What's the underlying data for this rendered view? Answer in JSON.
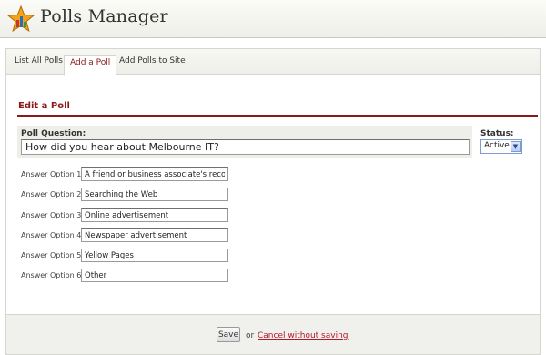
{
  "app": {
    "title": "Polls Manager",
    "logo_icon": "star-chart-icon"
  },
  "tabs": [
    {
      "label": "List All Polls",
      "active": false
    },
    {
      "label": "Add a Poll",
      "active": true
    },
    {
      "label": "Add Polls to Site",
      "active": false
    }
  ],
  "form": {
    "section_title": "Edit a Poll",
    "question_label": "Poll Question:",
    "question_value": "How did you hear about Melbourne IT?",
    "status_label": "Status:",
    "status_value": "Active",
    "answers": [
      {
        "label": "Answer Option 1:",
        "value": "A friend or business associate's recommendation"
      },
      {
        "label": "Answer Option 2:",
        "value": "Searching the Web"
      },
      {
        "label": "Answer Option 3:",
        "value": "Online advertisement"
      },
      {
        "label": "Answer Option 4:",
        "value": "Newspaper advertisement"
      },
      {
        "label": "Answer Option 5:",
        "value": "Yellow Pages"
      },
      {
        "label": "Answer Option 6:",
        "value": "Other"
      }
    ]
  },
  "footer": {
    "save_label": "Save",
    "or_text": "or",
    "cancel_label": "Cancel without saving"
  },
  "colors": {
    "accent": "#8b1a1a",
    "link": "#b3182b"
  }
}
